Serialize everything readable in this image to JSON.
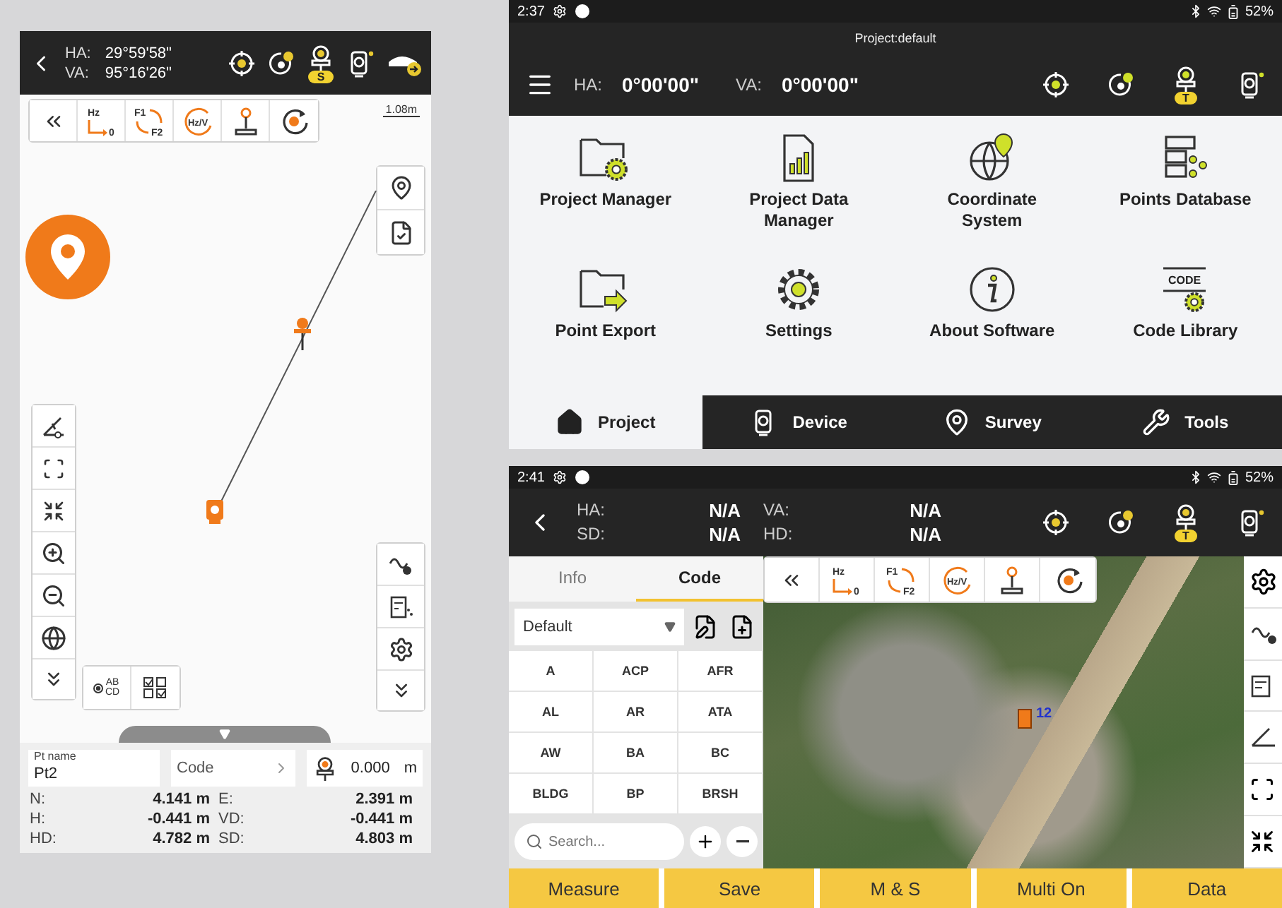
{
  "field_app": {
    "header": {
      "readings": [
        {
          "label": "HA:",
          "value": "29°59'58\""
        },
        {
          "label": "VA:",
          "value": "95°16'26\""
        }
      ],
      "prism_badge": "S"
    },
    "toolbar": [
      {
        "kind": "hz-zero",
        "texts": [
          "Hz",
          "0"
        ]
      },
      {
        "kind": "face-swap",
        "texts": [
          "F1",
          "F2"
        ]
      },
      {
        "kind": "hz-v",
        "texts": [
          "Hz/V"
        ]
      },
      {
        "kind": "joystick"
      },
      {
        "kind": "rotate"
      }
    ],
    "scale": "1.08m",
    "label_toggle": {
      "texts": [
        "AB",
        "CD"
      ]
    },
    "point_name": {
      "label": "Pt name",
      "value": "Pt2"
    },
    "code": {
      "placeholder": "Code"
    },
    "target_height": {
      "value": "0.000",
      "unit": "m"
    },
    "results": [
      {
        "label": "N:",
        "value": "4.141 m"
      },
      {
        "label": "E:",
        "value": "2.391 m"
      },
      {
        "label": "H:",
        "value": "-0.441 m"
      },
      {
        "label": "VD:",
        "value": "-0.441 m"
      },
      {
        "label": "HD:",
        "value": "4.782 m"
      },
      {
        "label": "SD:",
        "value": "4.803 m"
      }
    ]
  },
  "home_screen": {
    "status": {
      "time": "2:37",
      "battery": "52%"
    },
    "title": "Project:default",
    "readings": [
      {
        "label": "HA:",
        "value": "0°00'00\""
      },
      {
        "label": "VA:",
        "value": "0°00'00\""
      }
    ],
    "prism_badge": "T",
    "menu": [
      {
        "kind": "folder-gear",
        "label": "Project Manager"
      },
      {
        "kind": "report",
        "label": "Project Data Manager"
      },
      {
        "kind": "globe-pin",
        "label": "Coordinate System"
      },
      {
        "kind": "database",
        "label": "Points Database"
      },
      {
        "kind": "folder-export",
        "label": "Point Export"
      },
      {
        "kind": "gear",
        "label": "Settings"
      },
      {
        "kind": "info",
        "label": "About Software"
      },
      {
        "kind": "code",
        "label": "Code Library",
        "badge": "CODE"
      }
    ],
    "nav": [
      {
        "kind": "home",
        "label": "Project",
        "selected": true
      },
      {
        "kind": "station",
        "label": "Device",
        "selected": false
      },
      {
        "kind": "pin",
        "label": "Survey",
        "selected": false
      },
      {
        "kind": "tools",
        "label": "Tools",
        "selected": false
      }
    ]
  },
  "survey_screen": {
    "status": {
      "time": "2:41",
      "battery": "52%"
    },
    "readings": [
      {
        "label": "HA:",
        "value": "N/A"
      },
      {
        "label": "VA:",
        "value": "N/A"
      },
      {
        "label": "SD:",
        "value": "N/A"
      },
      {
        "label": "HD:",
        "value": "N/A"
      }
    ],
    "prism_badge": "T",
    "tabs": [
      {
        "label": "Info",
        "selected": false
      },
      {
        "label": "Code",
        "selected": true
      }
    ],
    "code_list": {
      "value": "Default"
    },
    "codes": [
      "A",
      "ACP",
      "AFR",
      "AL",
      "AR",
      "ATA",
      "AW",
      "BA",
      "BC",
      "BLDG",
      "BP",
      "BRSH"
    ],
    "search": {
      "placeholder": "Search..."
    },
    "toolbar": [
      {
        "kind": "hz-zero",
        "texts": [
          "Hz",
          "0"
        ]
      },
      {
        "kind": "face-swap",
        "texts": [
          "F1",
          "F2"
        ]
      },
      {
        "kind": "hz-v",
        "texts": [
          "Hz/V"
        ]
      },
      {
        "kind": "joystick"
      },
      {
        "kind": "rotate"
      }
    ],
    "map_point": "12",
    "actions": [
      "Measure",
      "Save",
      "M & S",
      "Multi On",
      "Data"
    ]
  }
}
